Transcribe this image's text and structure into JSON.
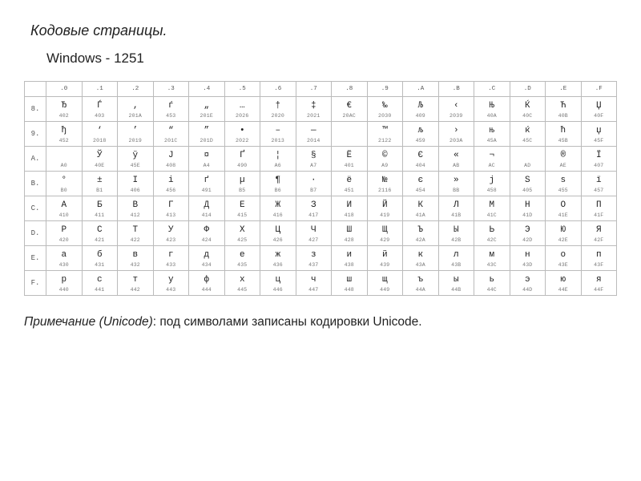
{
  "title": "Кодовые страницы.",
  "subtitle": "Windows - 1251",
  "footnote_label": "Примечание (Unicode)",
  "footnote_text": ": под символами записаны кодировки Unicode.",
  "col_headers": [
    ".0",
    ".1",
    ".2",
    ".3",
    ".4",
    ".5",
    ".6",
    ".7",
    ".8",
    ".9",
    ".A",
    ".B",
    ".C",
    ".D",
    ".E",
    ".F"
  ],
  "row_headers": [
    "8.",
    "9.",
    "A.",
    "B.",
    "C.",
    "D.",
    "E.",
    "F."
  ],
  "chart_data": {
    "type": "table",
    "rows": [
      [
        {
          "ch": "Ђ",
          "cd": "402"
        },
        {
          "ch": "Ѓ",
          "cd": "403"
        },
        {
          "ch": "‚",
          "cd": "201A"
        },
        {
          "ch": "ѓ",
          "cd": "453"
        },
        {
          "ch": "„",
          "cd": "201E"
        },
        {
          "ch": "…",
          "cd": "2026"
        },
        {
          "ch": "†",
          "cd": "2020"
        },
        {
          "ch": "‡",
          "cd": "2021"
        },
        {
          "ch": "€",
          "cd": "20AC"
        },
        {
          "ch": "‰",
          "cd": "2030"
        },
        {
          "ch": "Љ",
          "cd": "409"
        },
        {
          "ch": "‹",
          "cd": "2039"
        },
        {
          "ch": "Њ",
          "cd": "40A"
        },
        {
          "ch": "Ќ",
          "cd": "40C"
        },
        {
          "ch": "Ћ",
          "cd": "40B"
        },
        {
          "ch": "Џ",
          "cd": "40F"
        }
      ],
      [
        {
          "ch": "ђ",
          "cd": "452"
        },
        {
          "ch": "‘",
          "cd": "2018"
        },
        {
          "ch": "’",
          "cd": "2019"
        },
        {
          "ch": "“",
          "cd": "201C"
        },
        {
          "ch": "”",
          "cd": "201D"
        },
        {
          "ch": "•",
          "cd": "2022"
        },
        {
          "ch": "–",
          "cd": "2013"
        },
        {
          "ch": "—",
          "cd": "2014"
        },
        {
          "ch": "",
          "cd": ""
        },
        {
          "ch": "™",
          "cd": "2122"
        },
        {
          "ch": "љ",
          "cd": "459"
        },
        {
          "ch": "›",
          "cd": "203A"
        },
        {
          "ch": "њ",
          "cd": "45A"
        },
        {
          "ch": "ќ",
          "cd": "45C"
        },
        {
          "ch": "ћ",
          "cd": "45B"
        },
        {
          "ch": "џ",
          "cd": "45F"
        }
      ],
      [
        {
          "ch": " ",
          "cd": "A0"
        },
        {
          "ch": "Ў",
          "cd": "40E"
        },
        {
          "ch": "ў",
          "cd": "45E"
        },
        {
          "ch": "Ј",
          "cd": "408"
        },
        {
          "ch": "¤",
          "cd": "A4"
        },
        {
          "ch": "Ґ",
          "cd": "490"
        },
        {
          "ch": "¦",
          "cd": "A6"
        },
        {
          "ch": "§",
          "cd": "A7"
        },
        {
          "ch": "Ё",
          "cd": "401"
        },
        {
          "ch": "©",
          "cd": "A9"
        },
        {
          "ch": "Є",
          "cd": "404"
        },
        {
          "ch": "«",
          "cd": "AB"
        },
        {
          "ch": "¬",
          "cd": "AC"
        },
        {
          "ch": "­",
          "cd": "AD"
        },
        {
          "ch": "®",
          "cd": "AE"
        },
        {
          "ch": "Ї",
          "cd": "407"
        }
      ],
      [
        {
          "ch": "°",
          "cd": "B0"
        },
        {
          "ch": "±",
          "cd": "B1"
        },
        {
          "ch": "І",
          "cd": "406"
        },
        {
          "ch": "і",
          "cd": "456"
        },
        {
          "ch": "ґ",
          "cd": "491"
        },
        {
          "ch": "µ",
          "cd": "B5"
        },
        {
          "ch": "¶",
          "cd": "B6"
        },
        {
          "ch": "·",
          "cd": "B7"
        },
        {
          "ch": "ё",
          "cd": "451"
        },
        {
          "ch": "№",
          "cd": "2116"
        },
        {
          "ch": "є",
          "cd": "454"
        },
        {
          "ch": "»",
          "cd": "BB"
        },
        {
          "ch": "ј",
          "cd": "458"
        },
        {
          "ch": "Ѕ",
          "cd": "405"
        },
        {
          "ch": "ѕ",
          "cd": "455"
        },
        {
          "ch": "ї",
          "cd": "457"
        }
      ],
      [
        {
          "ch": "А",
          "cd": "410"
        },
        {
          "ch": "Б",
          "cd": "411"
        },
        {
          "ch": "В",
          "cd": "412"
        },
        {
          "ch": "Г",
          "cd": "413"
        },
        {
          "ch": "Д",
          "cd": "414"
        },
        {
          "ch": "Е",
          "cd": "415"
        },
        {
          "ch": "Ж",
          "cd": "416"
        },
        {
          "ch": "З",
          "cd": "417"
        },
        {
          "ch": "И",
          "cd": "418"
        },
        {
          "ch": "Й",
          "cd": "419"
        },
        {
          "ch": "К",
          "cd": "41A"
        },
        {
          "ch": "Л",
          "cd": "41B"
        },
        {
          "ch": "М",
          "cd": "41C"
        },
        {
          "ch": "Н",
          "cd": "41D"
        },
        {
          "ch": "О",
          "cd": "41E"
        },
        {
          "ch": "П",
          "cd": "41F"
        }
      ],
      [
        {
          "ch": "Р",
          "cd": "420"
        },
        {
          "ch": "С",
          "cd": "421"
        },
        {
          "ch": "Т",
          "cd": "422"
        },
        {
          "ch": "У",
          "cd": "423"
        },
        {
          "ch": "Ф",
          "cd": "424"
        },
        {
          "ch": "Х",
          "cd": "425"
        },
        {
          "ch": "Ц",
          "cd": "426"
        },
        {
          "ch": "Ч",
          "cd": "427"
        },
        {
          "ch": "Ш",
          "cd": "428"
        },
        {
          "ch": "Щ",
          "cd": "429"
        },
        {
          "ch": "Ъ",
          "cd": "42A"
        },
        {
          "ch": "Ы",
          "cd": "42B"
        },
        {
          "ch": "Ь",
          "cd": "42C"
        },
        {
          "ch": "Э",
          "cd": "42D"
        },
        {
          "ch": "Ю",
          "cd": "42E"
        },
        {
          "ch": "Я",
          "cd": "42F"
        }
      ],
      [
        {
          "ch": "а",
          "cd": "430"
        },
        {
          "ch": "б",
          "cd": "431"
        },
        {
          "ch": "в",
          "cd": "432"
        },
        {
          "ch": "г",
          "cd": "433"
        },
        {
          "ch": "д",
          "cd": "434"
        },
        {
          "ch": "е",
          "cd": "435"
        },
        {
          "ch": "ж",
          "cd": "436"
        },
        {
          "ch": "з",
          "cd": "437"
        },
        {
          "ch": "и",
          "cd": "438"
        },
        {
          "ch": "й",
          "cd": "439"
        },
        {
          "ch": "к",
          "cd": "43A"
        },
        {
          "ch": "л",
          "cd": "43B"
        },
        {
          "ch": "м",
          "cd": "43C"
        },
        {
          "ch": "н",
          "cd": "43D"
        },
        {
          "ch": "о",
          "cd": "43E"
        },
        {
          "ch": "п",
          "cd": "43F"
        }
      ],
      [
        {
          "ch": "р",
          "cd": "440"
        },
        {
          "ch": "с",
          "cd": "441"
        },
        {
          "ch": "т",
          "cd": "442"
        },
        {
          "ch": "у",
          "cd": "443"
        },
        {
          "ch": "ф",
          "cd": "444"
        },
        {
          "ch": "х",
          "cd": "445"
        },
        {
          "ch": "ц",
          "cd": "446"
        },
        {
          "ch": "ч",
          "cd": "447"
        },
        {
          "ch": "ш",
          "cd": "448"
        },
        {
          "ch": "щ",
          "cd": "449"
        },
        {
          "ch": "ъ",
          "cd": "44A"
        },
        {
          "ch": "ы",
          "cd": "44B"
        },
        {
          "ch": "ь",
          "cd": "44C"
        },
        {
          "ch": "э",
          "cd": "44D"
        },
        {
          "ch": "ю",
          "cd": "44E"
        },
        {
          "ch": "я",
          "cd": "44F"
        }
      ]
    ]
  }
}
